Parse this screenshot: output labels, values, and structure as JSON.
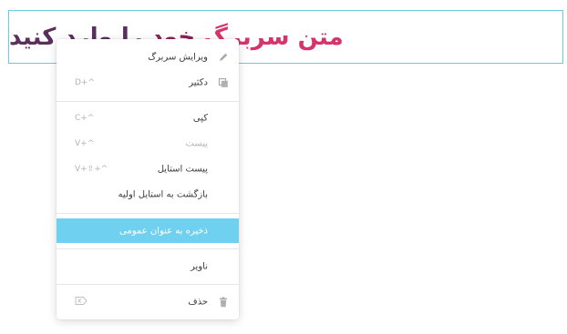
{
  "heading": {
    "parts": [
      {
        "text": "متن سربرگ ",
        "color": "#d6336c"
      },
      {
        "text": "خود ",
        "color": "#8e1f5b"
      },
      {
        "text": "را وارد کنید",
        "color": "#5a2f5e"
      }
    ]
  },
  "colors": {
    "border": "#6ec9e0",
    "highlight": "#6fd1ef"
  },
  "menu": {
    "items": [
      {
        "label": "ویرایش سربرگ",
        "shortcut": "",
        "icon": "pencil-icon",
        "disabled": false
      },
      {
        "label": "دکثیر",
        "shortcut": "D+^",
        "icon": "duplicate-icon",
        "disabled": false
      },
      {
        "label": "کپی",
        "shortcut": "C+^",
        "icon": "",
        "disabled": false
      },
      {
        "label": "پیست",
        "shortcut": "V+^",
        "icon": "",
        "disabled": true
      },
      {
        "label": "پیست استایل",
        "shortcut": "V+⇧+^",
        "icon": "",
        "disabled": false
      },
      {
        "label": "بازگشت به استایل اولیه",
        "shortcut": "",
        "icon": "",
        "disabled": false
      },
      {
        "label": "ذخیره به عنوان عمومی",
        "shortcut": "",
        "icon": "",
        "disabled": false,
        "active": true
      },
      {
        "label": "ناویر",
        "shortcut": "",
        "icon": "",
        "disabled": false
      },
      {
        "label": "حذف",
        "shortcut": "⌦",
        "icon": "trash-icon",
        "disabled": false
      }
    ]
  }
}
